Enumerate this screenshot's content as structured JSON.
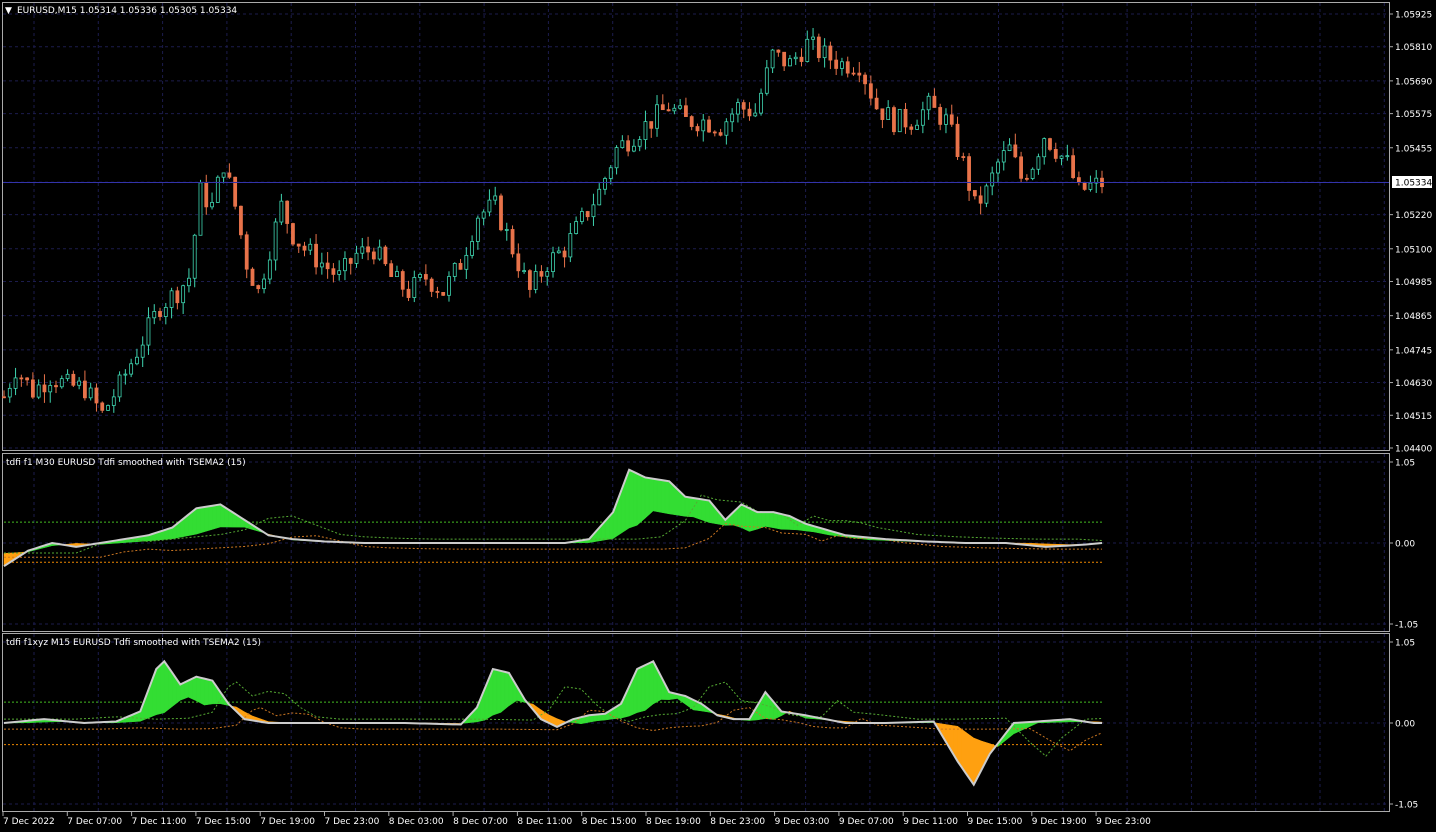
{
  "main": {
    "title": "EURUSD,M15  1.05314 1.05336 1.05305 1.05334",
    "y_ticks": [
      "1.05925",
      "1.05810",
      "1.05690",
      "1.05575",
      "1.05455",
      "1.05334",
      "1.05220",
      "1.05100",
      "1.04985",
      "1.04865",
      "1.04745",
      "1.04630",
      "1.04515",
      "1.04400"
    ],
    "ylim": [
      1.044,
      1.05925
    ],
    "current_price": "1.05334",
    "colors": {
      "bull": "#3fd5b0",
      "bear": "#e8734a",
      "grid": "#1c1c4d",
      "price_line": "#3333aa"
    }
  },
  "panel1": {
    "title": "tdfi f1 M30 EURUSD Tdfi smoothed with TSEMA2 (15)",
    "y_ticks": [
      "1.05",
      "0.00",
      "-1.05"
    ],
    "ylim": [
      -1.05,
      1.05
    ],
    "levels": [
      0.27,
      -0.25
    ]
  },
  "panel2": {
    "title": "tdfi f1xyz M15 EURUSD Tdfi smoothed with TSEMA2 (15)",
    "y_ticks": [
      "1.05",
      "0.00",
      "-1.05"
    ],
    "ylim": [
      -1.05,
      1.05
    ],
    "levels": [
      0.27,
      -0.28
    ]
  },
  "x_axis": {
    "labels": [
      "7 Dec 2022",
      "7 Dec 07:00",
      "7 Dec 11:00",
      "7 Dec 15:00",
      "7 Dec 19:00",
      "7 Dec 23:00",
      "8 Dec 03:00",
      "8 Dec 07:00",
      "8 Dec 11:00",
      "8 Dec 15:00",
      "8 Dec 19:00",
      "8 Dec 23:00",
      "9 Dec 03:00",
      "9 Dec 07:00",
      "9 Dec 11:00",
      "9 Dec 15:00",
      "9 Dec 19:00",
      "9 Dec 23:00"
    ]
  },
  "chart_data": [
    {
      "type": "candlestick",
      "title": "EURUSD,M15",
      "ylim": [
        1.044,
        1.05925
      ],
      "x_range": [
        "7 Dec 2022 03:00",
        "9 Dec 23:45"
      ],
      "close_path": [
        [
          0,
          1.0458
        ],
        [
          2,
          1.0468
        ],
        [
          5,
          1.046
        ],
        [
          8,
          1.0465
        ],
        [
          11,
          1.0462
        ],
        [
          14,
          1.0461
        ],
        [
          17,
          1.0452
        ],
        [
          20,
          1.0462
        ],
        [
          24,
          1.0478
        ],
        [
          27,
          1.049
        ],
        [
          30,
          1.0495
        ],
        [
          32,
          1.05
        ],
        [
          34,
          1.053
        ],
        [
          36,
          1.0525
        ],
        [
          38,
          1.054
        ],
        [
          40,
          1.0525
        ],
        [
          42,
          1.0505
        ],
        [
          44,
          1.0495
        ],
        [
          46,
          1.051
        ],
        [
          48,
          1.0525
        ],
        [
          50,
          1.0515
        ],
        [
          52,
          1.051
        ],
        [
          55,
          1.0505
        ],
        [
          58,
          1.05
        ],
        [
          61,
          1.0508
        ],
        [
          64,
          1.051
        ],
        [
          67,
          1.05
        ],
        [
          70,
          1.0495
        ],
        [
          73,
          1.05
        ],
        [
          76,
          1.0495
        ],
        [
          79,
          1.0505
        ],
        [
          82,
          1.0522
        ],
        [
          85,
          1.0525
        ],
        [
          88,
          1.051
        ],
        [
          91,
          1.0495
        ],
        [
          94,
          1.0505
        ],
        [
          97,
          1.051
        ],
        [
          100,
          1.052
        ],
        [
          103,
          1.053
        ],
        [
          106,
          1.0545
        ],
        [
          109,
          1.055
        ],
        [
          112,
          1.0555
        ],
        [
          115,
          1.056
        ],
        [
          118,
          1.0555
        ],
        [
          121,
          1.0555
        ],
        [
          124,
          1.0553
        ],
        [
          127,
          1.056
        ],
        [
          130,
          1.0558
        ],
        [
          133,
          1.0578
        ],
        [
          136,
          1.0575
        ],
        [
          139,
          1.0582
        ],
        [
          142,
          1.0578
        ],
        [
          145,
          1.0575
        ],
        [
          148,
          1.0575
        ],
        [
          151,
          1.056
        ],
        [
          154,
          1.0555
        ],
        [
          157,
          1.0555
        ],
        [
          160,
          1.056
        ],
        [
          163,
          1.0555
        ],
        [
          166,
          1.054
        ],
        [
          168,
          1.0525
        ],
        [
          170,
          1.053
        ],
        [
          172,
          1.054
        ],
        [
          174,
          1.0545
        ],
        [
          176,
          1.0535
        ],
        [
          178,
          1.054
        ],
        [
          180,
          1.055
        ],
        [
          182,
          1.0545
        ],
        [
          184,
          1.054
        ],
        [
          186,
          1.053
        ],
        [
          188,
          1.0532
        ],
        [
          190,
          1.0533
        ]
      ]
    },
    {
      "type": "area",
      "title": "tdfi f1 M30 EURUSD Tdfi smoothed with TSEMA2 (15)",
      "ylim": [
        -1.05,
        1.05
      ],
      "series": [
        {
          "name": "tdfi",
          "values": [
            [
              0,
              -0.3
            ],
            [
              3,
              -0.1
            ],
            [
              6,
              0.0
            ],
            [
              9,
              -0.05
            ],
            [
              12,
              0.0
            ],
            [
              15,
              0.05
            ],
            [
              18,
              0.1
            ],
            [
              21,
              0.2
            ],
            [
              24,
              0.45
            ],
            [
              27,
              0.5
            ],
            [
              30,
              0.3
            ],
            [
              33,
              0.1
            ],
            [
              36,
              0.05
            ],
            [
              40,
              0.02
            ],
            [
              45,
              0.0
            ],
            [
              50,
              0.0
            ],
            [
              55,
              0.0
            ],
            [
              60,
              0.0
            ],
            [
              65,
              0.0
            ],
            [
              70,
              0.0
            ],
            [
              73,
              0.05
            ],
            [
              76,
              0.4
            ],
            [
              78,
              0.95
            ],
            [
              80,
              0.85
            ],
            [
              83,
              0.8
            ],
            [
              85,
              0.6
            ],
            [
              88,
              0.55
            ],
            [
              90,
              0.3
            ],
            [
              92,
              0.5
            ],
            [
              94,
              0.4
            ],
            [
              96,
              0.4
            ],
            [
              98,
              0.35
            ],
            [
              100,
              0.25
            ],
            [
              105,
              0.1
            ],
            [
              110,
              0.05
            ],
            [
              115,
              0.02
            ],
            [
              120,
              0.0
            ],
            [
              125,
              0.0
            ],
            [
              130,
              -0.05
            ],
            [
              135,
              -0.02
            ],
            [
              137,
              0.0
            ]
          ]
        }
      ]
    },
    {
      "type": "area",
      "title": "tdfi f1xyz M15 EURUSD Tdfi smoothed with TSEMA2 (15)",
      "ylim": [
        -1.05,
        1.05
      ],
      "series": [
        {
          "name": "tdfi",
          "values": [
            [
              0,
              0.0
            ],
            [
              5,
              0.05
            ],
            [
              10,
              0.0
            ],
            [
              14,
              0.02
            ],
            [
              17,
              0.15
            ],
            [
              19,
              0.7
            ],
            [
              20,
              0.8
            ],
            [
              22,
              0.5
            ],
            [
              24,
              0.6
            ],
            [
              26,
              0.55
            ],
            [
              28,
              0.25
            ],
            [
              30,
              0.05
            ],
            [
              33,
              0.0
            ],
            [
              40,
              0.0
            ],
            [
              50,
              0.0
            ],
            [
              57,
              -0.02
            ],
            [
              59,
              0.2
            ],
            [
              61,
              0.7
            ],
            [
              63,
              0.65
            ],
            [
              65,
              0.3
            ],
            [
              67,
              0.05
            ],
            [
              69,
              -0.05
            ],
            [
              71,
              0.05
            ],
            [
              73,
              0.1
            ],
            [
              75,
              0.12
            ],
            [
              77,
              0.25
            ],
            [
              79,
              0.7
            ],
            [
              81,
              0.8
            ],
            [
              83,
              0.4
            ],
            [
              85,
              0.35
            ],
            [
              87,
              0.25
            ],
            [
              89,
              0.1
            ],
            [
              91,
              0.05
            ],
            [
              93,
              0.05
            ],
            [
              95,
              0.4
            ],
            [
              97,
              0.15
            ],
            [
              100,
              0.1
            ],
            [
              105,
              0.0
            ],
            [
              110,
              0.0
            ],
            [
              116,
              0.02
            ],
            [
              119,
              -0.5
            ],
            [
              121,
              -0.8
            ],
            [
              123,
              -0.4
            ],
            [
              126,
              0.0
            ],
            [
              129,
              0.02
            ],
            [
              133,
              0.05
            ],
            [
              136,
              0.0
            ]
          ]
        }
      ]
    }
  ]
}
